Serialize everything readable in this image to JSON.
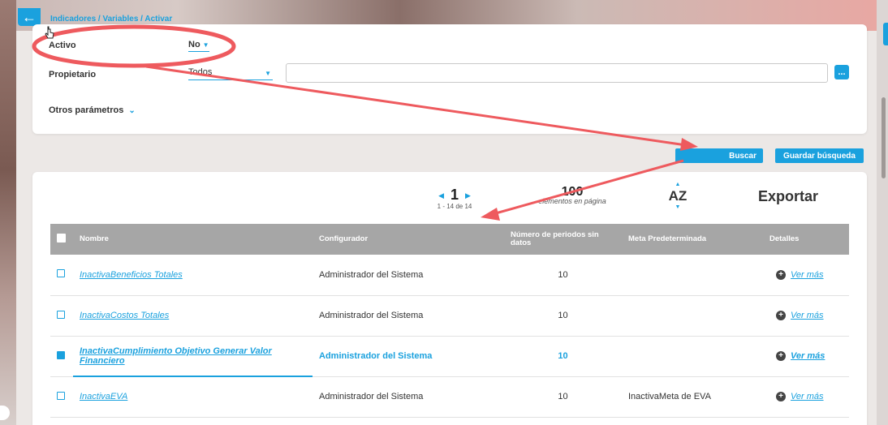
{
  "nav": {
    "back_icon": "arrow-left-icon",
    "breadcrumb": "Indicadores / Variables / Activar"
  },
  "filters": {
    "activo_label": "Activo",
    "activo_value": "No",
    "propietario_label": "Propietario",
    "propietario_value": "Todos",
    "propietario_input": "",
    "more_button_label": "...",
    "otros_label": "Otros parámetros"
  },
  "actions": {
    "buscar": "Buscar",
    "guardar": "Guardar búsqueda"
  },
  "results": {
    "page_number": "1",
    "page_range": "1 - 14 de 14",
    "per_page_value": "100",
    "per_page_label": "elementos en página",
    "sort_label": "AZ",
    "export_label": "Exportar",
    "headers": {
      "nombre": "Nombre",
      "configurador": "Configurador",
      "numero_periodos": "Número de periodos sin datos",
      "meta": "Meta Predeterminada",
      "detalles": "Detalles"
    },
    "rows": [
      {
        "name": "InactivaBeneficios Totales",
        "configurador": "Administrador del Sistema",
        "periodos": "10",
        "meta": "",
        "detail": "Ver más",
        "selected": false
      },
      {
        "name": "InactivaCostos Totales",
        "configurador": "Administrador del Sistema",
        "periodos": "10",
        "meta": "",
        "detail": "Ver más",
        "selected": false
      },
      {
        "name": "InactivaCumplimiento Objetivo Generar Valor Financiero",
        "configurador": "Administrador del Sistema",
        "periodos": "10",
        "meta": "",
        "detail": "Ver más",
        "selected": true
      },
      {
        "name": "InactivaEVA",
        "configurador": "Administrador del Sistema",
        "periodos": "10",
        "meta": "InactivaMeta de EVA",
        "detail": "Ver más",
        "selected": false
      }
    ]
  },
  "colors": {
    "accent": "#1aa1de",
    "header_gray": "#a6a6a6",
    "annotation_red": "#ee5a5e"
  }
}
